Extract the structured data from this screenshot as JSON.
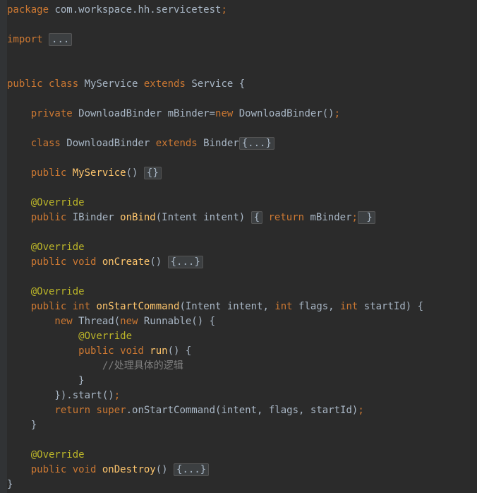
{
  "code": {
    "line1_package": "package",
    "line1_pkg": " com.workspace.hh.servicetest",
    "line3_import": "import",
    "line3_dots": "...",
    "line5_public": "public",
    "line5_class": " class",
    "line5_name": " MyService",
    "line5_extends": " extends",
    "line5_super": " Service {",
    "line7_private": "    private",
    "line7_type": " DownloadBinder mBinder=",
    "line7_new": "new",
    "line7_ctor": " DownloadBinder()",
    "line9_class": "    class",
    "line9_name": " DownloadBinder",
    "line9_extends": " extends",
    "line9_super": " Binder",
    "line9_fold": "{...}",
    "line11_public": "    public",
    "line11_method": " MyService",
    "line11_params": "() ",
    "line11_fold": "{}",
    "line13_anno": "    @Override",
    "line14_public": "    public",
    "line14_ret": " IBinder",
    "line14_method": " onBind",
    "line14_params": "(Intent intent) ",
    "line14_fold1": "{",
    "line14_return": " return",
    "line14_expr": " mBinder",
    "line14_fold2": " }",
    "line16_anno": "    @Override",
    "line17_public": "    public",
    "line17_void": " void",
    "line17_method": " onCreate",
    "line17_params": "() ",
    "line17_fold": "{...}",
    "line19_anno": "    @Override",
    "line20_public": "    public",
    "line20_int": " int",
    "line20_method": " onStartCommand",
    "line20_params": "(Intent intent, ",
    "line20_int2": "int",
    "line20_params2": " flags, ",
    "line20_int3": "int",
    "line20_params3": " startId) {",
    "line21_new": "        new",
    "line21_thread": " Thread(",
    "line21_new2": "new",
    "line21_runnable": " Runnable() {",
    "line22_anno": "            @Override",
    "line23_public": "            public",
    "line23_void": " void",
    "line23_method": " run",
    "line23_params": "() {",
    "line24_comment": "                //处理具体的逻辑",
    "line25_brace": "            }",
    "line26_close": "        }).start()",
    "line27_return": "        return",
    "line27_super": " super",
    "line27_call": ".onStartCommand(intent, flags, startId)",
    "line28_brace": "    }",
    "line30_anno": "    @Override",
    "line31_public": "    public",
    "line31_void": " void",
    "line31_method": " onDestroy",
    "line31_params": "() ",
    "line31_fold": "{...}",
    "line32_brace": "}",
    "semi": ";"
  }
}
